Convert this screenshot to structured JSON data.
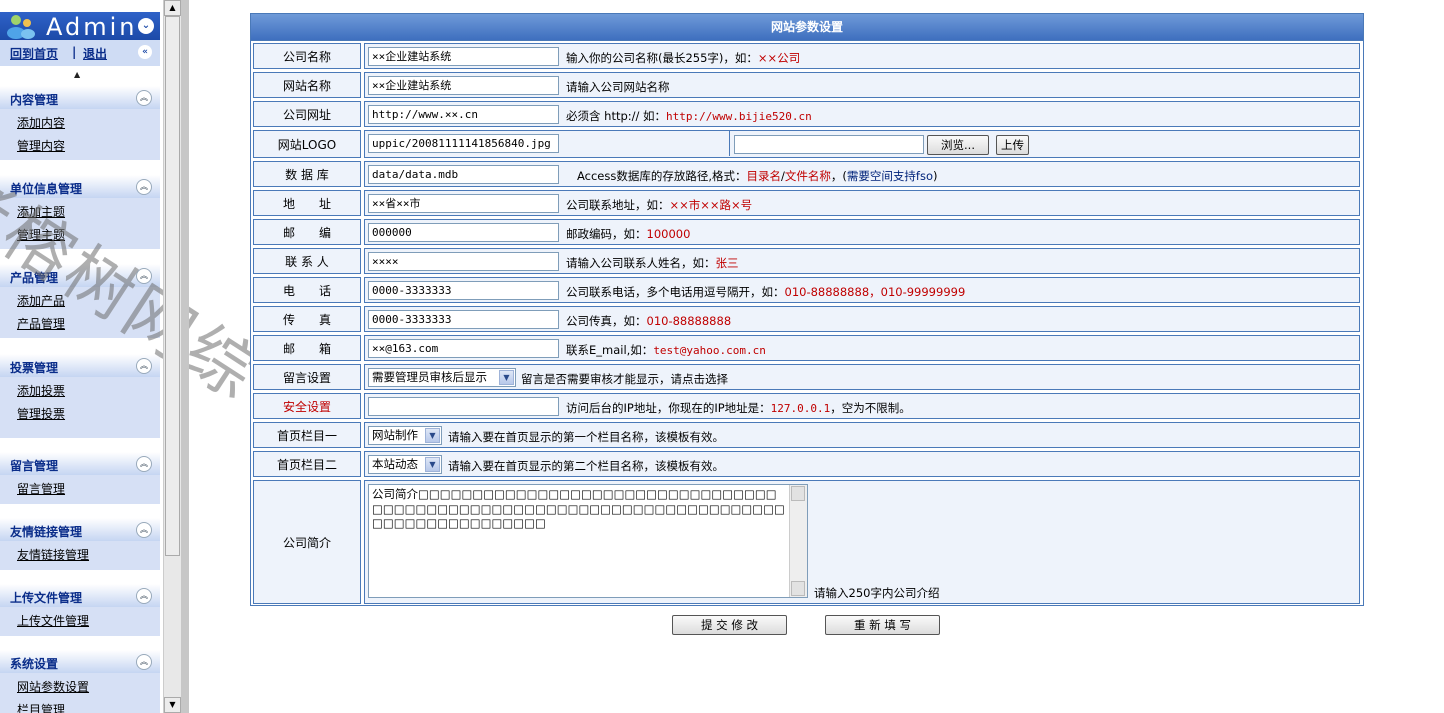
{
  "sidebar": {
    "logo_text": "Admin",
    "nav_home": "回到首页",
    "nav_sep": "|",
    "nav_logout": "退出",
    "menus": [
      {
        "title": "内容管理",
        "items": [
          "添加内容",
          "管理内容"
        ]
      },
      {
        "title": "单位信息管理",
        "items": [
          "添加主题",
          "管理主题"
        ]
      },
      {
        "title": "产品管理",
        "items": [
          "添加产品",
          "产品管理"
        ]
      },
      {
        "title": "投票管理",
        "items": [
          "添加投票",
          "管理投票"
        ]
      },
      {
        "title": "留言管理",
        "items": [
          "留言管理"
        ]
      },
      {
        "title": "友情链接管理",
        "items": [
          "友情链接管理"
        ]
      },
      {
        "title": "上传文件管理",
        "items": [
          "上传文件管理"
        ]
      },
      {
        "title": "系统设置",
        "items": [
          "网站参数设置",
          "栏目管理"
        ]
      }
    ]
  },
  "watermark": "老榕树网综",
  "form": {
    "title": "网站参数设置",
    "company_name": {
      "label": "公司名称",
      "value": "××企业建站系统",
      "hint": "输入你的公司名称(最长255字)，如：",
      "example": "××公司"
    },
    "site_name": {
      "label": "网站名称",
      "value": "××企业建站系统",
      "hint": "请输入公司网站名称"
    },
    "company_url": {
      "label": "公司网址",
      "value": "http://www.××.cn",
      "hint": "必须含 http:// 如：",
      "example": "http://www.bijie520.cn"
    },
    "site_logo": {
      "label": "网站LOGO",
      "value": "uppic/20081111141856840.jpg",
      "browse": "浏览...",
      "upload": "上传"
    },
    "database": {
      "label": "数 据 库",
      "value": "data/data.mdb",
      "hint": "Access数据库的存放路径,格式：",
      "ex1": "目录名",
      "ex_sep": "/",
      "ex2": "文件名称",
      "ex3": "，(",
      "ex4": "需要空间支持fso",
      "ex5": ")"
    },
    "address": {
      "label": "地　　址",
      "value": "××省××市",
      "hint": "公司联系地址，如：",
      "example": "××市××路×号"
    },
    "postcode": {
      "label": "邮　　编",
      "value": "000000",
      "hint": "邮政编码，如：",
      "example": "100000"
    },
    "contact": {
      "label": "联 系 人",
      "value": "××××",
      "hint": "请输入公司联系人姓名，如：",
      "example": "张三"
    },
    "phone": {
      "label": "电　　话",
      "value": "0000-3333333",
      "hint": "公司联系电话，多个电话用逗号隔开，如：",
      "example": "010-88888888，010-99999999"
    },
    "fax": {
      "label": "传　　真",
      "value": "0000-3333333",
      "hint": "公司传真，如：",
      "example": "010-88888888"
    },
    "email": {
      "label": "邮　　箱",
      "value": "××@163.com",
      "hint": "联系E_mail,如：",
      "example": "test@yahoo.com.cn"
    },
    "guestbook": {
      "label": "留言设置",
      "value": "需要管理员审核后显示",
      "hint": "留言是否需要审核才能显示，请点击选择"
    },
    "security": {
      "label": "安全设置",
      "value": "",
      "hint": "访问后台的IP地址，你现在的IP地址是：",
      "example": "127.0.0.1",
      "hint2": "，空为不限制。"
    },
    "home_col1": {
      "label": "首页栏目一",
      "value": "网站制作",
      "hint": "请输入要在首页显示的第一个栏目名称，该模板有效。"
    },
    "home_col2": {
      "label": "首页栏目二",
      "value": "本站动态",
      "hint": "请输入要在首页显示的第二个栏目名称，该模板有效。"
    },
    "intro": {
      "label": "公司简介",
      "value": "公司简介□□□□□□□□□□□□□□□□□□□□□□□□□□□□□□□□□□□□□□□□□□□□□□□□□□□□□□□□□□□□□□□□□□□□□□□□□□□□□□□□□□□□□□□",
      "hint": "请输入250字内公司介绍"
    },
    "submit": "提 交 修 改",
    "reset": "重 新 填 写"
  },
  "colors": {
    "accent": "#3e6fbf",
    "border": "#4a79b8",
    "example_red": "#c00000",
    "menu_title": "#0a2d8a"
  }
}
